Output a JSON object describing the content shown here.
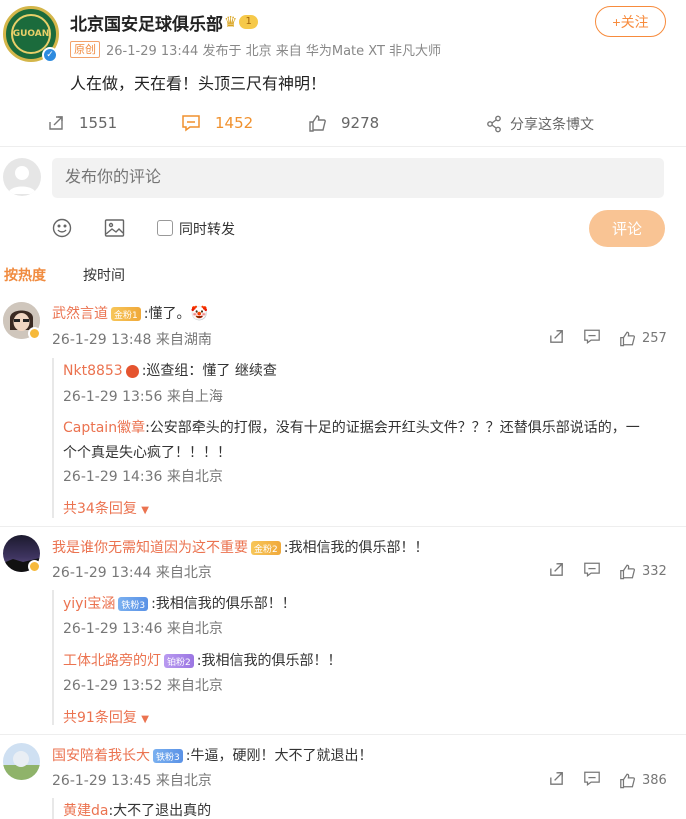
{
  "post": {
    "author": "北京国安足球俱乐部",
    "avatar_text": "GUOAN",
    "level_badge": "1",
    "original_tag": "原创",
    "meta": "26-1-29 13:44 发布于 北京 来自 华为Mate XT 非凡大师",
    "follow_label": "+关注",
    "text": "人在做，天在看！头顶三尺有神明！",
    "reposts": "1551",
    "comments": "1452",
    "likes": "9278",
    "share_label": "分享这条博文"
  },
  "composer": {
    "placeholder": "发布你的评论",
    "repost_label": "同时转发",
    "submit_label": "评论"
  },
  "sort": {
    "hot": "按热度",
    "time": "按时间"
  },
  "comments": [
    {
      "name": "武然言道",
      "badge": "金粉1",
      "text": ":懂了。🤡",
      "meta": "26-1-29 13:48 来自湖南",
      "likes": "257",
      "replies": [
        {
          "name": "Nkt8853",
          "text": ":巡查组：懂了 继续查",
          "meta": "26-1-29 13:56 来自上海"
        },
        {
          "name": "Captain徽章",
          "text": ":公安部牵头的打假，没有十足的证据会开红头文件？？？还替俱乐部说话的，一",
          "text2": "个个真是失心疯了！！！！",
          "meta": "26-1-29 14:36 来自北京"
        }
      ],
      "more": "共34条回复"
    },
    {
      "name": "我是谁你无需知道因为这不重要",
      "badge": "金粉2",
      "text": ":我相信我的俱乐部！！",
      "meta": "26-1-29 13:44 来自北京",
      "likes": "332",
      "replies": [
        {
          "name": "yiyi宝涵",
          "badge": "铁粉3",
          "text": ":我相信我的俱乐部！！",
          "meta": "26-1-29 13:46 来自北京"
        },
        {
          "name": "工体北路旁的灯",
          "badge": "铂粉2",
          "text": ":我相信我的俱乐部！！",
          "meta": "26-1-29 13:52 来自北京"
        }
      ],
      "more": "共91条回复"
    },
    {
      "name": "国安陪着我长大",
      "badge": "铁粉3",
      "text": ":牛逼，硬刚！大不了就退出！",
      "meta": "26-1-29 13:45 来自北京",
      "likes": "386",
      "replies": [
        {
          "name": "黄建da",
          "text": ":大不了退出真的"
        }
      ]
    }
  ],
  "colors": {
    "accent": "#f08b3f",
    "username": "#eb7350",
    "meta": "#777777"
  }
}
